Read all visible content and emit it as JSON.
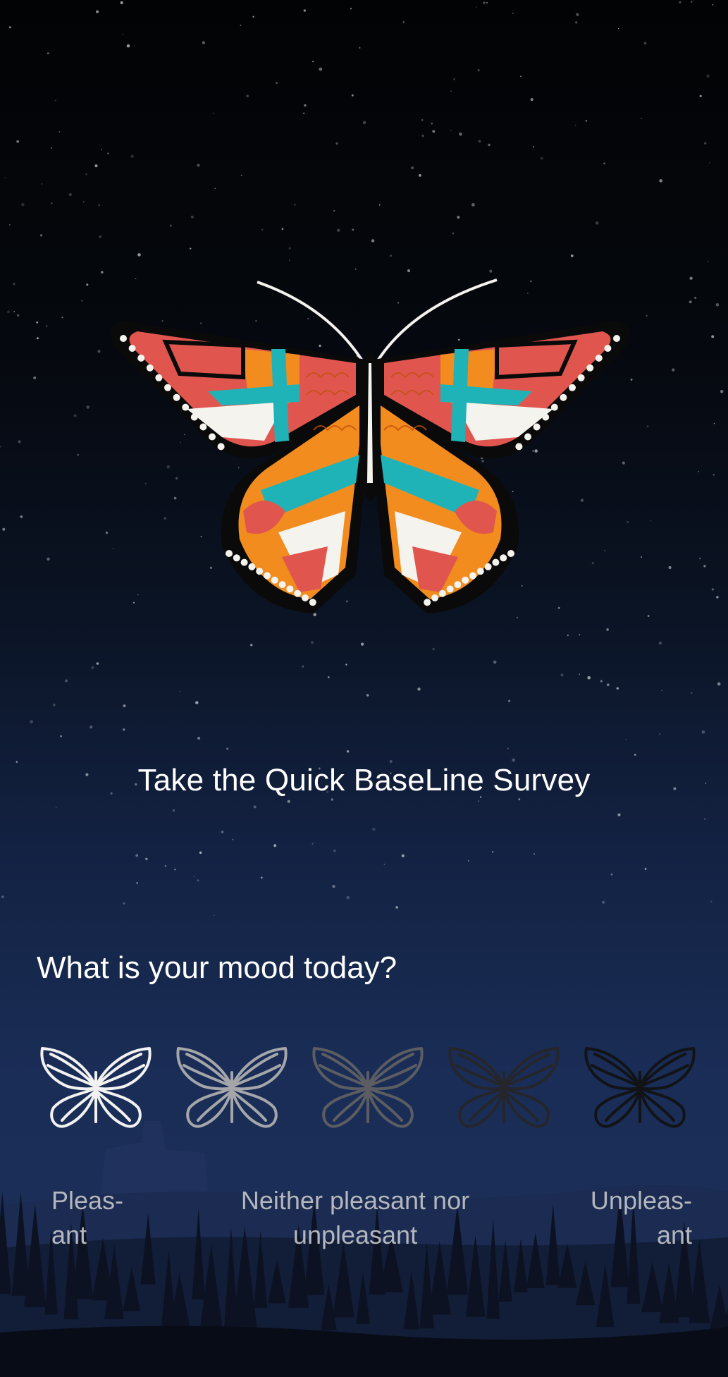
{
  "survey": {
    "title": "Take the Quick BaseLine Survey",
    "question": "What is your mood today?"
  },
  "mood_scale": {
    "options": [
      {
        "icon": "butterfly-outline-icon",
        "color": "#f2f2f2"
      },
      {
        "icon": "butterfly-outline-icon",
        "color": "#a4a6aa"
      },
      {
        "icon": "butterfly-outline-icon",
        "color": "#5b5d62"
      },
      {
        "icon": "butterfly-outline-icon",
        "color": "#24262b"
      },
      {
        "icon": "butterfly-outline-icon",
        "color": "#111317"
      }
    ],
    "label_left_line1": "Pleas-",
    "label_left_line2": "ant",
    "label_mid_line1": "Neither pleasant nor",
    "label_mid_line2": "unpleasant",
    "label_right_line1": "Unpleas-",
    "label_right_line2": "ant"
  },
  "colors": {
    "wing_red": "#e0564f",
    "wing_orange": "#f28c1e",
    "wing_teal": "#1fb3b8",
    "wing_white": "#f5f3ee",
    "outline": "#0a0a0a"
  }
}
